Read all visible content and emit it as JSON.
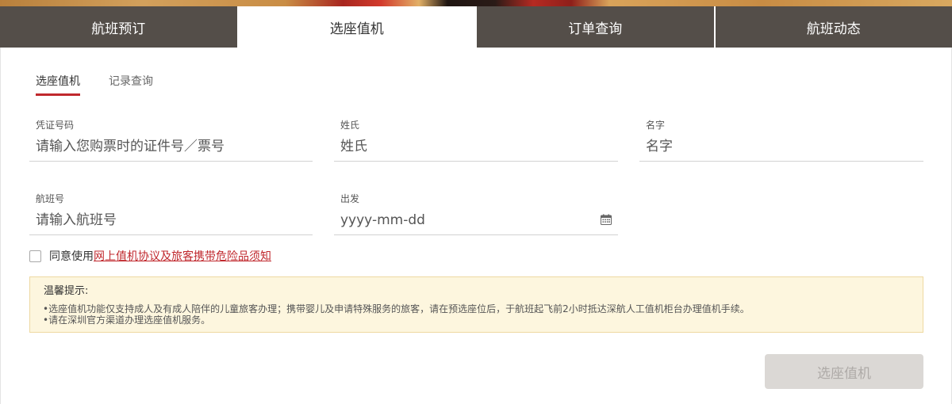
{
  "colors": {
    "accent": "#c0282d",
    "tab_inactive": "#544e49",
    "notice_bg": "#fdf6de",
    "notice_border": "#eed9a2",
    "button_disabled_bg": "#dbd8d5"
  },
  "top_tabs": [
    {
      "label": "航班预订",
      "active": false
    },
    {
      "label": "选座值机",
      "active": true
    },
    {
      "label": "订单查询",
      "active": false
    },
    {
      "label": "航班动态",
      "active": false
    }
  ],
  "sub_tabs": [
    {
      "label": "选座值机",
      "active": true
    },
    {
      "label": "记录查询",
      "active": false
    }
  ],
  "form": {
    "certificate_number": {
      "label": "凭证号码",
      "placeholder": "请输入您购票时的证件号／票号"
    },
    "last_name": {
      "label": "姓氏",
      "placeholder": "姓氏"
    },
    "first_name": {
      "label": "名字",
      "placeholder": "名字"
    },
    "flight_number": {
      "label": "航班号",
      "placeholder": "请输入航班号"
    },
    "departure_date": {
      "label": "出发",
      "placeholder": "yyyy-mm-dd",
      "icon": "calendar-icon"
    }
  },
  "agreement": {
    "checked": false,
    "prefix": "同意使用",
    "link_text": "网上值机协议及旅客携带危险品须知"
  },
  "notice": {
    "title": "温馨提示:",
    "lines": [
      "•选座值机功能仅支持成人及有成人陪伴的儿童旅客办理；携带婴儿及申请特殊服务的旅客，请在预选座位后，于航班起飞前2小时抵达深航人工值机柜台办理值机手续。",
      "•请在深圳官方渠道办理选座值机服务。"
    ]
  },
  "submit": {
    "label": "选座值机",
    "disabled": true
  }
}
